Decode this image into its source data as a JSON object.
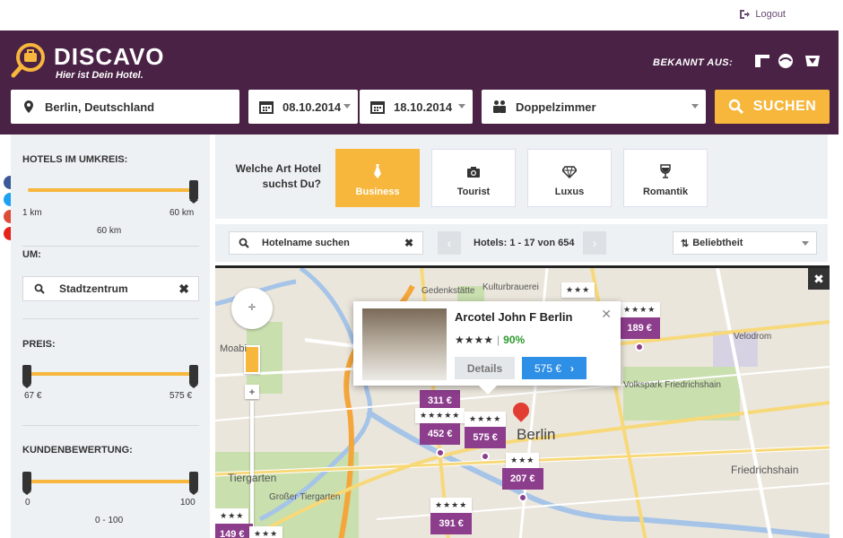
{
  "topbar": {
    "logout_label": "Logout"
  },
  "header": {
    "brand": "DISCAVO",
    "tagline": "Hier ist Dein Hotel.",
    "known_from": "BEKANNT AUS:",
    "location": "Berlin, Deutschland",
    "checkin": "08.10.2014",
    "checkout": "18.10.2014",
    "room": "Doppelzimmer",
    "search_label": "SUCHEN"
  },
  "sidebar": {
    "radius_label": "HOTELS IM UMKREIS:",
    "radius_min": "1 km",
    "radius_max": "60 km",
    "radius_value": "60 km",
    "around_label": "UM:",
    "around_value": "Stadtzentrum",
    "price_label": "PREIS:",
    "price_min": "67 €",
    "price_max": "575 €",
    "rating_label": "KUNDENBEWERTUNG:",
    "rating_min": "0",
    "rating_max": "100",
    "rating_value": "0 - 100"
  },
  "hotel_type": {
    "question": "Welche Art Hotel suchst Du?",
    "types": [
      {
        "label": "Business",
        "icon": "tie-icon",
        "active": true
      },
      {
        "label": "Tourist",
        "icon": "camera-icon",
        "active": false
      },
      {
        "label": "Luxus",
        "icon": "diamond-icon",
        "active": false
      },
      {
        "label": "Romantik",
        "icon": "wine-glass-icon",
        "active": false
      }
    ]
  },
  "filter": {
    "search_placeholder": "Hotelname suchen",
    "count": "Hotels: 1 - 17 von 654",
    "sort": "Beliebtheit"
  },
  "popup": {
    "name": "Arcotel John F Berlin",
    "stars": "★★★★",
    "rating": "90%",
    "details_label": "Details",
    "price": "575 €"
  },
  "map": {
    "labels": {
      "gedenkstaette": "Gedenkstätte",
      "kulturbrauerei": "Kulturbrauerei",
      "volkspark": "Volkspark Friedrichshain",
      "velodrom": "Velodrom",
      "tiergarten": "Tiergarten",
      "grosser_tiergarten": "Großer Tiergarten",
      "friedrichshain": "Friedrichshain",
      "berlin": "Berlin",
      "moabit": "Moabi"
    },
    "markers": [
      {
        "stars": "★★★",
        "price": ""
      },
      {
        "stars": "★★★★",
        "price": "189 €"
      },
      {
        "stars": "",
        "price": "311 €"
      },
      {
        "stars": "★★★★★",
        "price": "452 €"
      },
      {
        "stars": "★★★★",
        "price": "575 €"
      },
      {
        "stars": "★★★",
        "price": "207 €"
      },
      {
        "stars": "★★★★",
        "price": "391 €"
      },
      {
        "stars": "★★★",
        "price": "149 €"
      },
      {
        "stars": "★★★",
        "price": ""
      }
    ]
  },
  "colors": {
    "brand": "#4a2246",
    "accent": "#f6b73c",
    "marker": "#8c3d8c"
  }
}
